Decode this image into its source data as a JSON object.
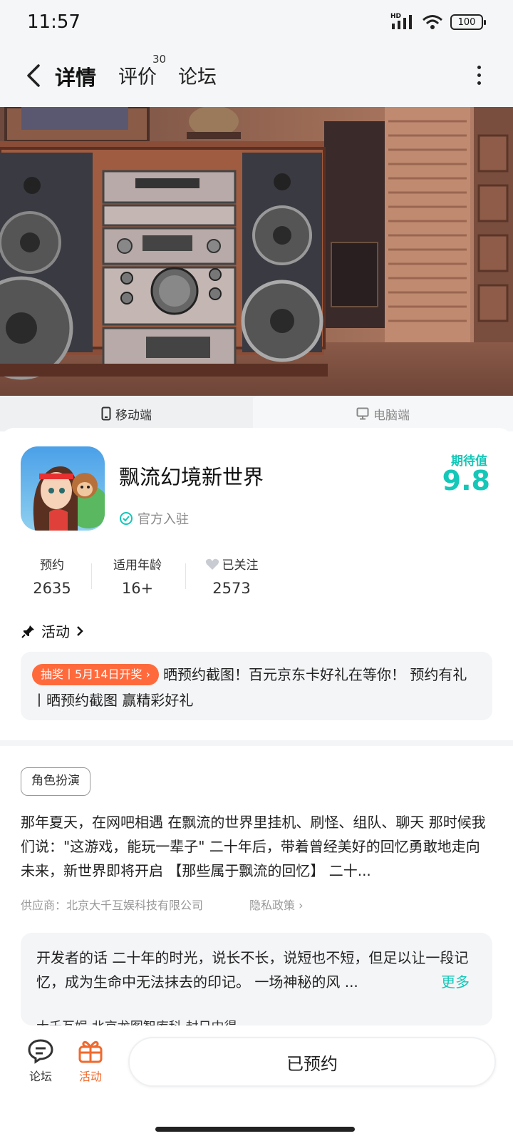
{
  "status_bar": {
    "time": "11:57",
    "network": "HD",
    "battery": "100"
  },
  "nav": {
    "tabs": [
      {
        "label": "详情"
      },
      {
        "label": "评价",
        "badge": "30"
      },
      {
        "label": "论坛"
      }
    ]
  },
  "platform_tabs": {
    "mobile": "移动端",
    "pc": "电脑端"
  },
  "game": {
    "title": "飘流幻境新世界",
    "official_label": "官方入驻",
    "expect_label": "期待值",
    "expect_value": "9.8"
  },
  "stats": [
    {
      "label": "预约",
      "value": "2635"
    },
    {
      "label": "适用年龄",
      "value": "16+"
    },
    {
      "label": "已关注",
      "value": "2573"
    }
  ],
  "activity": {
    "header": "活动",
    "badge": "抽奖丨5月14日开奖",
    "text": "晒预约截图！百元京东卡好礼在等你！ 预约有礼丨晒预约截图 赢精彩好礼"
  },
  "tag": "角色扮演",
  "description": "那年夏天，在网吧相遇 在飘流的世界里挂机、刷怪、组队、聊天 那时候我们说：\"这游戏，能玩一辈子\" 二十年后，带着曾经美好的回忆勇敢地走向未来，新世界即将开启 【那些属于飘流的回忆】 二十...",
  "supplier": "供应商：北京大千互娱科技有限公司",
  "privacy": "隐私政策",
  "developer": {
    "text": "开发者的话  二十年的时光，说长不长，说短也不短，但足以让一段记忆，成为生命中无法抹去的印记。 一场神秘的风 ...",
    "more": "更多",
    "partners": "大千互娱          北京龙图智库科          封日中得"
  },
  "bottom": {
    "forum": "论坛",
    "activity": "活动",
    "reserve": "已预约"
  },
  "colors": {
    "accent": "#15c7b8",
    "orange": "#f06a2d",
    "badge": "#ff6a3d"
  }
}
